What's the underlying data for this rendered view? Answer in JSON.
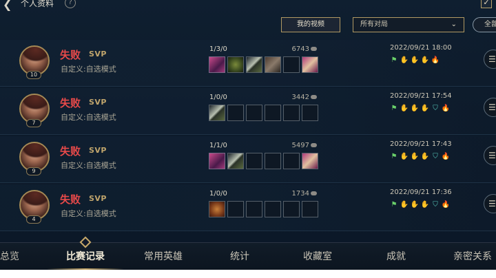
{
  "header": {
    "title": "个人资料",
    "help": "?",
    "check": "✓"
  },
  "toolbar": {
    "video_label": "我的视频",
    "mode_value": "所有对局",
    "all_label": "全部"
  },
  "matches": [
    {
      "level": "10",
      "result": "失败",
      "badge": "SVP",
      "mode": "自定义:自选模式",
      "kda": "1/3/0",
      "gold": "6743",
      "date": "2022/09/21 18:00",
      "items": [
        "pink",
        "green",
        "sword",
        "brown",
        "empty",
        "boots"
      ],
      "icons": [
        "flag",
        "hands",
        "hands",
        "hands",
        "fire"
      ]
    },
    {
      "level": "7",
      "result": "失败",
      "badge": "SVP",
      "mode": "自定义:自选模式",
      "kda": "1/0/0",
      "gold": "3442",
      "date": "2022/09/21 17:54",
      "items": [
        "sword",
        "empty",
        "empty",
        "empty",
        "empty",
        "empty"
      ],
      "icons": [
        "flag",
        "hands",
        "hands",
        "hands",
        "shield",
        "fire"
      ]
    },
    {
      "level": "9",
      "result": "失败",
      "badge": "SVP",
      "mode": "自定义:自选模式",
      "kda": "1/1/0",
      "gold": "5497",
      "date": "2022/09/21 17:43",
      "items": [
        "pink",
        "sword",
        "empty",
        "empty",
        "empty",
        "boots"
      ],
      "icons": [
        "flag",
        "hands",
        "hands",
        "hands",
        "shield",
        "fire"
      ]
    },
    {
      "level": "4",
      "result": "失败",
      "badge": "SVP",
      "mode": "自定义:自选模式",
      "kda": "1/0/0",
      "gold": "1734",
      "date": "2022/09/21 17:36",
      "items": [
        "orange",
        "empty",
        "empty",
        "empty",
        "empty",
        "empty"
      ],
      "icons": [
        "flag",
        "hands",
        "hands",
        "hands",
        "shield",
        "fire"
      ]
    }
  ],
  "tabs": [
    {
      "label": "总览"
    },
    {
      "label": "比赛记录",
      "active": true
    },
    {
      "label": "常用英雄"
    },
    {
      "label": "统计"
    },
    {
      "label": "收藏室"
    },
    {
      "label": "成就"
    },
    {
      "label": "亲密关系"
    }
  ],
  "colors": {
    "accent": "#c7a96a",
    "defeat": "#e84a4a",
    "background": "#0c1a2a"
  }
}
